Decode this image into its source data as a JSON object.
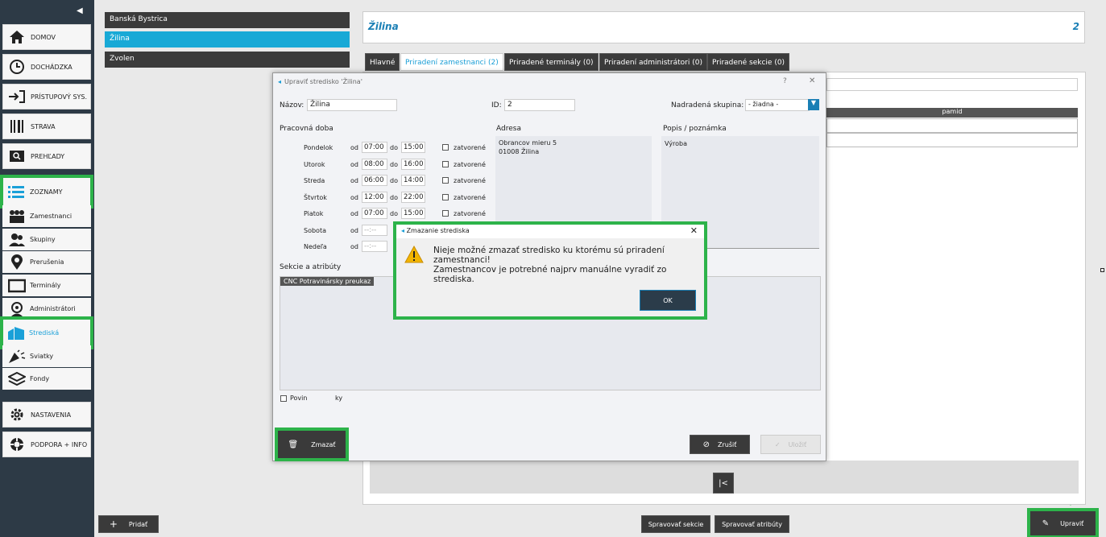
{
  "sidebar": {
    "collapse_glyph": "◀",
    "nav": [
      {
        "label": "DOMOV",
        "icon": "home-icon"
      },
      {
        "label": "DOCHÁDZKA",
        "icon": "clock-icon"
      },
      {
        "label": "PRÍSTUPOVÝ SYS.",
        "icon": "login-icon"
      },
      {
        "label": "STRAVA",
        "icon": "cutlery-icon"
      },
      {
        "label": "PREHĽADY",
        "icon": "search-icon"
      },
      {
        "label": "ZOZNAMY",
        "icon": "list-icon"
      }
    ],
    "sub": [
      {
        "label": "Zamestnanci",
        "icon": "people-icon"
      },
      {
        "label": "Skupiny",
        "icon": "group-icon"
      },
      {
        "label": "Prerušenia",
        "icon": "pin-icon"
      },
      {
        "label": "Terminály",
        "icon": "monitor-icon"
      },
      {
        "label": "Administrátori",
        "icon": "admin-icon"
      },
      {
        "label": "Strediská",
        "icon": "building-icon"
      },
      {
        "label": "Sviatky",
        "icon": "party-icon"
      },
      {
        "label": "Fondy",
        "icon": "layers-icon"
      }
    ],
    "bottom": [
      {
        "label": "NASTAVENIA",
        "icon": "gear-icon"
      },
      {
        "label": "PODPORA + INFO",
        "icon": "lifebuoy-icon"
      }
    ]
  },
  "centers": [
    "Banská Bystrica",
    "Žilina",
    "Zvolen"
  ],
  "detail": {
    "title": "Žilina",
    "count": "2"
  },
  "tabs": [
    "Hlavné",
    "Priradení zamestnanci (2)",
    "Priradené terminály (0)",
    "Priradení administrátori (0)",
    "Priradené sekcie (0)"
  ],
  "grid": {
    "column": "pamid"
  },
  "dialog": {
    "title": "Upraviť stredisko 'Žilina'",
    "help": "?",
    "close": "✕",
    "name_label": "Názov:",
    "name_value": "Žilina",
    "id_label": "ID:",
    "id_value": "2",
    "parent_label": "Nadradená skupina:",
    "parent_value": "- žiadna -",
    "hours_label": "Pracovná doba",
    "address_label": "Adresa",
    "address_line1": "Obrancov mieru 5",
    "address_line2": "01008 Žilina",
    "note_label": "Popis / poznámka",
    "note_value": "Výroba",
    "from": "od",
    "to": "do",
    "closed": "zatvorené",
    "days": [
      {
        "name": "Pondelok",
        "from": "07:00",
        "to": "15:00"
      },
      {
        "name": "Utorok",
        "from": "08:00",
        "to": "16:00"
      },
      {
        "name": "Streda",
        "from": "06:00",
        "to": "14:00"
      },
      {
        "name": "Štvrtok",
        "from": "12:00",
        "to": "22:00"
      },
      {
        "name": "Piatok",
        "from": "07:00",
        "to": "15:00"
      },
      {
        "name": "Sobota",
        "from": "--:--",
        "to": ""
      },
      {
        "name": "Nedeľa",
        "from": "--:--",
        "to": ""
      }
    ],
    "sections_label": "Sekcie a atribúty",
    "sections_chip": "CNC   Potravinársky preukaz",
    "mandatory_label": "Povin",
    "mandatory_tail": "ky",
    "delete_label": "Zmazať",
    "cancel_label": "Zrušiť",
    "save_label": "Uložiť"
  },
  "message": {
    "title": "Zmazanie strediska",
    "close": "✕",
    "line1": "Nieje možné zmazať stredisko ku ktorému sú priradení",
    "line2": "zamestnanci!",
    "line3": "Zamestnancov je potrebné najprv manuálne vyradiť zo strediska.",
    "ok": "OK"
  },
  "footer": {
    "add": "Pridať",
    "add_glyph": "+",
    "manage_sections": "Spravovať sekcie",
    "manage_attributes": "Spravovať atribúty",
    "edit": "Upraviť",
    "pager_first": "|<"
  }
}
